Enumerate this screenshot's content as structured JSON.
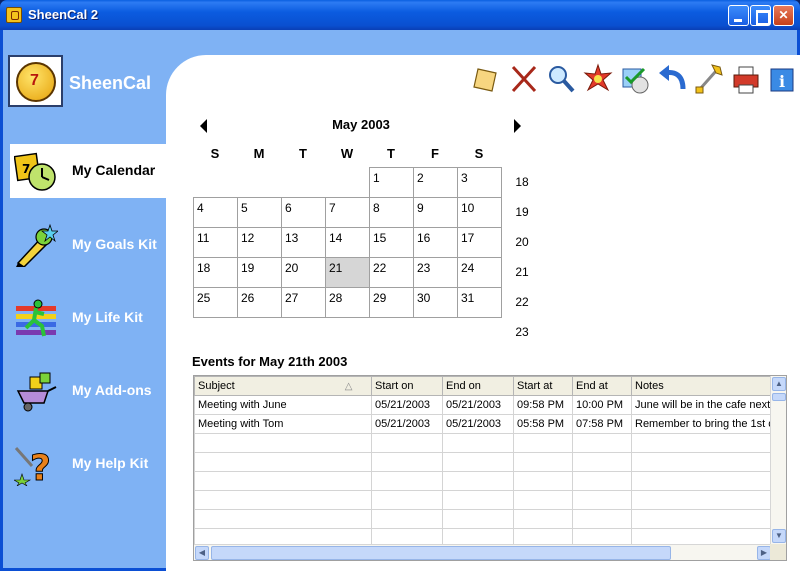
{
  "window": {
    "title": "SheenCal 2"
  },
  "sidebar": {
    "brand": "SheenCal",
    "items": [
      {
        "label": "My Calendar",
        "icon": "calendar-clock-icon",
        "active": true
      },
      {
        "label": "My Goals Kit",
        "icon": "pencil-star-icon",
        "active": false
      },
      {
        "label": "My Life Kit",
        "icon": "running-man-icon",
        "active": false
      },
      {
        "label": "My Add-ons",
        "icon": "puzzle-wheelbarrow-icon",
        "active": false
      },
      {
        "label": "My Help Kit",
        "icon": "question-tools-icon",
        "active": false
      }
    ]
  },
  "toolbar": [
    {
      "icon": "note-icon"
    },
    {
      "icon": "delete-x-icon"
    },
    {
      "icon": "search-magnifier-icon"
    },
    {
      "icon": "star-burst-icon"
    },
    {
      "icon": "disc-check-icon"
    },
    {
      "icon": "undo-arrow-icon"
    },
    {
      "icon": "tools-icon"
    },
    {
      "icon": "printer-icon"
    },
    {
      "icon": "info-icon"
    }
  ],
  "calendar": {
    "month_title": "May 2003",
    "weekdays": [
      "S",
      "M",
      "T",
      "W",
      "T",
      "F",
      "S"
    ],
    "weeks": [
      [
        "",
        "",
        "",
        "",
        "1",
        "2",
        "3"
      ],
      [
        "4",
        "5",
        "6",
        "7",
        "8",
        "9",
        "10"
      ],
      [
        "11",
        "12",
        "13",
        "14",
        "15",
        "16",
        "17"
      ],
      [
        "18",
        "19",
        "20",
        "21",
        "22",
        "23",
        "24"
      ],
      [
        "25",
        "26",
        "27",
        "28",
        "29",
        "30",
        "31"
      ]
    ],
    "selected_day": "21",
    "week_numbers": [
      "18",
      "19",
      "20",
      "21",
      "22",
      "23"
    ]
  },
  "events": {
    "title": "Events for May 21th 2003",
    "columns": [
      "Subject",
      "Start on",
      "End on",
      "Start at",
      "End at",
      "Notes"
    ],
    "rows": [
      [
        "Meeting with June",
        "05/21/2003",
        "05/21/2003",
        "09:58 PM",
        "10:00 PM",
        "June will be in the cafe next"
      ],
      [
        "Meeting with Tom",
        "05/21/2003",
        "05/21/2003",
        "05:58 PM",
        "07:58 PM",
        "Remember to bring the 1st c"
      ]
    ],
    "empty_rows": 6
  },
  "colors": {
    "titlebar": "#0b5ce0",
    "sidebar": "#7fb2f4",
    "selected_day": "#d6d6d6"
  }
}
